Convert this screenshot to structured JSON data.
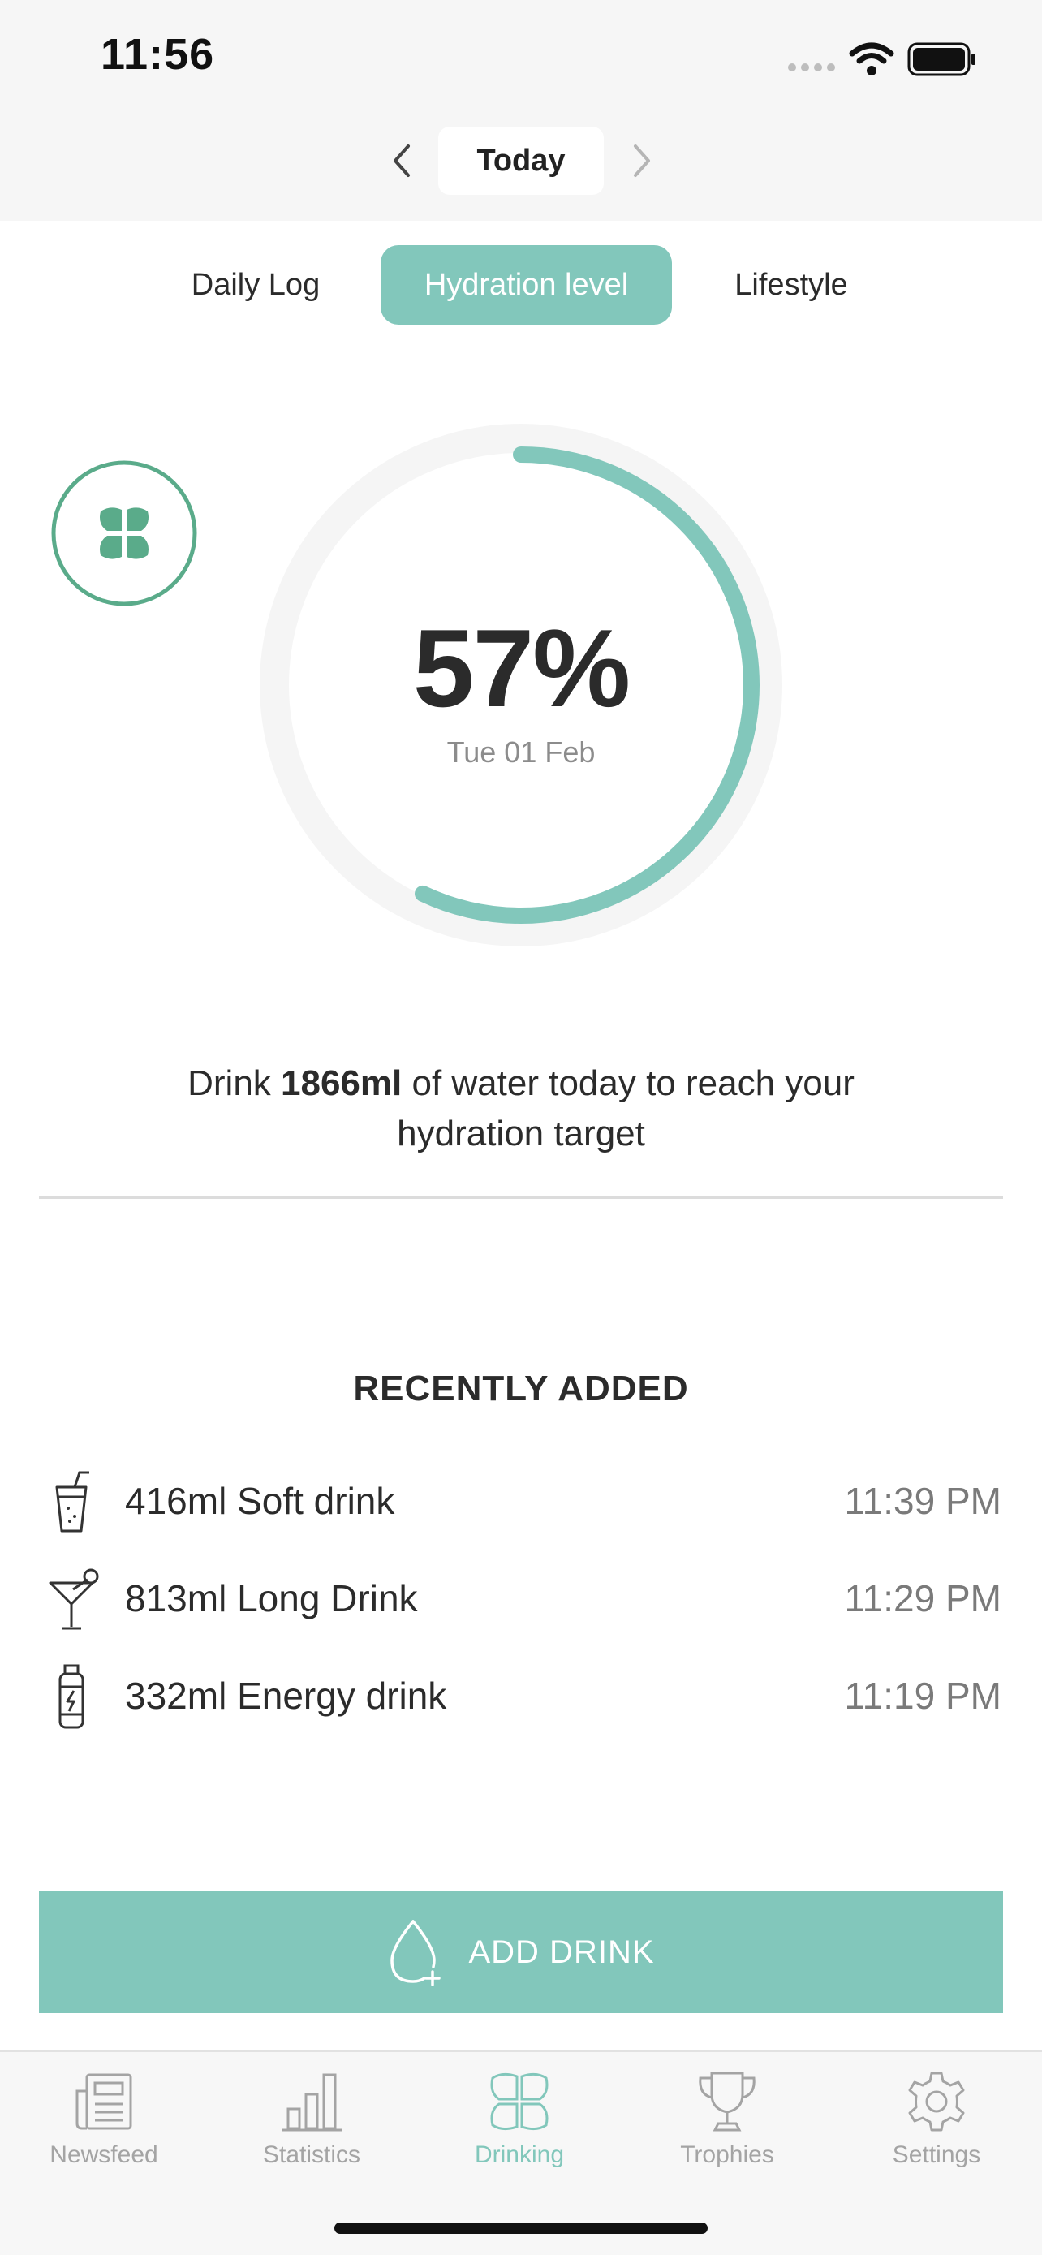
{
  "status_bar": {
    "time": "11:56",
    "icons": [
      "signal-icon",
      "wifi-icon",
      "battery-icon"
    ]
  },
  "date_nav": {
    "label": "Today",
    "prev_icon": "chevron-left-icon",
    "next_icon": "chevron-right-icon"
  },
  "tabs": [
    {
      "label": "Daily Log",
      "active": false
    },
    {
      "label": "Hydration level",
      "active": true
    },
    {
      "label": "Lifestyle",
      "active": false
    }
  ],
  "hydration": {
    "percent_text": "57%",
    "percent": 57,
    "date": "Tue 01 Feb"
  },
  "message": {
    "prefix": "Drink ",
    "amount": "1866ml",
    "suffix": " of water today to reach your hydration target"
  },
  "recent": {
    "title": "RECENTLY ADDED",
    "items": [
      {
        "icon": "soft-drink-icon",
        "name": "416ml Soft drink",
        "time": "11:39 PM"
      },
      {
        "icon": "cocktail-icon",
        "name": "813ml Long Drink",
        "time": "11:29 PM"
      },
      {
        "icon": "energy-drink-icon",
        "name": "332ml Energy drink",
        "time": "11:19 PM"
      }
    ]
  },
  "add_button": {
    "label": "ADD DRINK",
    "icon": "droplet-plus-icon"
  },
  "bottom_nav": [
    {
      "label": "Newsfeed",
      "icon": "newspaper-icon",
      "active": false
    },
    {
      "label": "Statistics",
      "icon": "bar-chart-icon",
      "active": false
    },
    {
      "label": "Drinking",
      "icon": "clover-icon",
      "active": true
    },
    {
      "label": "Trophies",
      "icon": "trophy-icon",
      "active": false
    },
    {
      "label": "Settings",
      "icon": "gear-icon",
      "active": false
    }
  ],
  "colors": {
    "accent": "#82c7bb",
    "badge": "#5aab8a",
    "text": "#2b2b2b",
    "muted": "#8c8c8c",
    "ring_track": "#f5f5f5"
  }
}
